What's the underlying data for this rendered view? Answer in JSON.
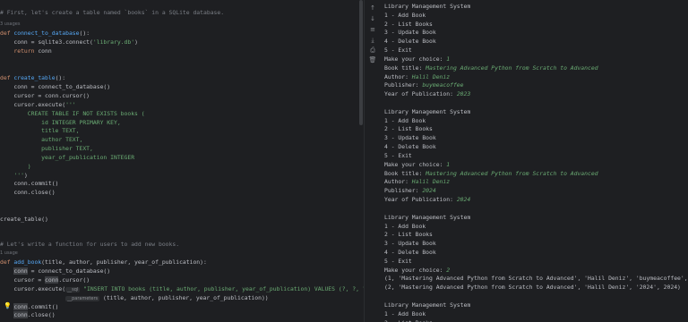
{
  "editor": {
    "lines": [
      {
        "t": "cm",
        "text": "# First, let's create a table named `books` in a SQLite database."
      },
      {
        "t": "hint",
        "text": "3 usages"
      },
      {
        "t": "def",
        "kw": "def ",
        "name": "connect_to_database",
        "rest": "():"
      },
      {
        "t": "plain",
        "text": "    conn = sqlite3.connect(",
        "str": "'library.db'",
        "end": ")"
      },
      {
        "t": "ret",
        "kw": "    return ",
        "rest": "conn"
      },
      {
        "t": "blank"
      },
      {
        "t": "blank"
      },
      {
        "t": "def",
        "kw": "def ",
        "name": "create_table",
        "rest": "():"
      },
      {
        "t": "text",
        "text": "    conn = connect_to_database()"
      },
      {
        "t": "text",
        "text": "    cursor = conn.cursor()"
      },
      {
        "t": "plain",
        "text": "    cursor.execute(",
        "str": "'''",
        "end": ""
      },
      {
        "t": "strline",
        "text": "        CREATE TABLE IF NOT EXISTS books ("
      },
      {
        "t": "strline",
        "text": "            id INTEGER PRIMARY KEY,"
      },
      {
        "t": "strline",
        "text": "            title TEXT,"
      },
      {
        "t": "strline",
        "text": "            author TEXT,"
      },
      {
        "t": "strline",
        "text": "            publisher TEXT,"
      },
      {
        "t": "strline",
        "text": "            year_of_publication INTEGER"
      },
      {
        "t": "strline",
        "text": "        )"
      },
      {
        "t": "strend",
        "str": "    '''",
        "end": ")"
      },
      {
        "t": "text",
        "text": "    conn.commit()"
      },
      {
        "t": "text",
        "text": "    conn.close()"
      },
      {
        "t": "blank"
      },
      {
        "t": "blank"
      },
      {
        "t": "text",
        "text": "create_table()"
      },
      {
        "t": "blank"
      },
      {
        "t": "blank"
      },
      {
        "t": "cm",
        "text": "# Let's write a function for users to add new books."
      },
      {
        "t": "hint",
        "text": "1 usage"
      },
      {
        "t": "def",
        "kw": "def ",
        "name": "add_book",
        "rest": "(title, author, publisher, year_of_publication):"
      },
      {
        "t": "hlconn",
        "pre": "    ",
        "hl": "conn",
        "rest": " = connect_to_database()"
      },
      {
        "t": "hlconn2",
        "pre": "    cursor = ",
        "hl": "conn",
        "rest": ".cursor()"
      },
      {
        "t": "exec",
        "pre": "    cursor.execute(",
        "inlay": "__sql",
        "str": "\"INSERT INTO books (title, author, publisher, year_of_publication) VALUES (?, ?, ?, ?)\"",
        "end": ","
      },
      {
        "t": "params",
        "pre": "                   ",
        "inlay": "__parameters",
        "rest": " (title, author, publisher, year_of_publication))"
      },
      {
        "t": "hlconn2",
        "pre": "    ",
        "hl": "conn",
        "rest": ".commit()"
      },
      {
        "t": "hlconn2",
        "pre": "    ",
        "hl": "conn",
        "rest": ".close()"
      }
    ]
  },
  "gutter_icons": [
    "arrow-up-icon",
    "arrow-down-icon",
    "soft-wrap-icon",
    "scroll-to-end-icon",
    "print-icon",
    "trash-icon"
  ],
  "gutter_glyphs": [
    "↑",
    "↓",
    "≡",
    "⤓",
    "⎙",
    "🗑"
  ],
  "console": {
    "lines": [
      {
        "text": "Library Management System"
      },
      {
        "text": "1 - Add Book"
      },
      {
        "text": "2 - List Books"
      },
      {
        "text": "3 - Update Book"
      },
      {
        "text": "4 - Delete Book"
      },
      {
        "text": "5 - Exit"
      },
      {
        "text": "Make your choice: ",
        "input": "1"
      },
      {
        "text": "Book title: ",
        "input": "Mastering Advanced Python from Scratch to Advanced"
      },
      {
        "text": "Author: ",
        "input": "Halil Deniz"
      },
      {
        "text": "Publisher: ",
        "input": "buymeacoffee"
      },
      {
        "text": "Year of Publication: ",
        "input": "2023"
      },
      {
        "text": ""
      },
      {
        "text": "Library Management System"
      },
      {
        "text": "1 - Add Book"
      },
      {
        "text": "2 - List Books"
      },
      {
        "text": "3 - Update Book"
      },
      {
        "text": "4 - Delete Book"
      },
      {
        "text": "5 - Exit"
      },
      {
        "text": "Make your choice: ",
        "input": "1"
      },
      {
        "text": "Book title: ",
        "input": "Mastering Advanced Python from Scratch to Advanced"
      },
      {
        "text": "Author: ",
        "input": "Halil Deniz"
      },
      {
        "text": "Publisher: ",
        "input": "2024"
      },
      {
        "text": "Year of Publication: ",
        "input": "2024"
      },
      {
        "text": ""
      },
      {
        "text": "Library Management System"
      },
      {
        "text": "1 - Add Book"
      },
      {
        "text": "2 - List Books"
      },
      {
        "text": "3 - Update Book"
      },
      {
        "text": "4 - Delete Book"
      },
      {
        "text": "5 - Exit"
      },
      {
        "text": "Make your choice: ",
        "input": "2"
      },
      {
        "text": "(1, 'Mastering Advanced Python from Scratch to Advanced', 'Halil Deniz', 'buymeacoffee', 2023)"
      },
      {
        "text": "(2, 'Mastering Advanced Python from Scratch to Advanced', 'Halil Deniz', '2024', 2024)"
      },
      {
        "text": ""
      },
      {
        "text": "Library Management System"
      },
      {
        "text": "1 - Add Book"
      },
      {
        "text": "2 - List Books"
      }
    ]
  },
  "colors": {
    "background": "#1e1f22",
    "keyword": "#cf8e6d",
    "function": "#56a8f5",
    "string": "#6aab73",
    "comment": "#7a7e85"
  }
}
